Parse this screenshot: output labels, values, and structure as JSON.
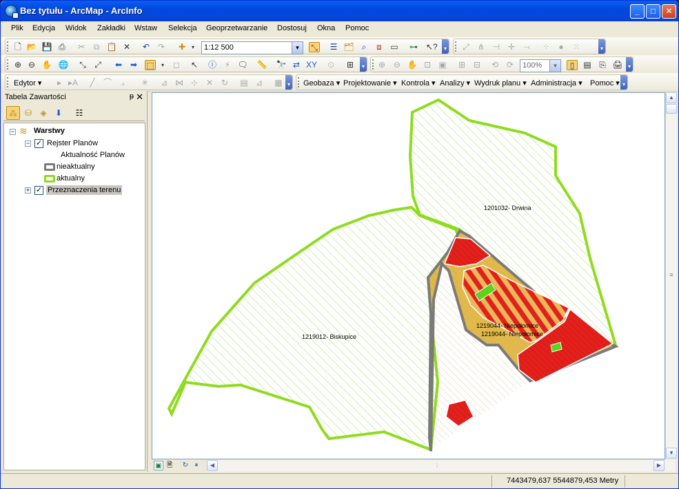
{
  "window": {
    "title": "Bez tytułu - ArcMap - ArcInfo",
    "minimize": "_",
    "maximize": "□",
    "close": "✕"
  },
  "menu": {
    "items": [
      "Plik",
      "Edycja",
      "Widok",
      "Zakładki",
      "Wstaw",
      "Selekcja",
      "Geoprzetwarzanie",
      "Dostosuj",
      "Okna",
      "Pomoc"
    ]
  },
  "toolbar": {
    "scale": "1:12 500",
    "zoom_percent": "100%",
    "editor_label": "Edytor ▾",
    "geoprocessing_menus": [
      "Geobaza ▾",
      "Projektowanie ▾",
      "Kontrola ▾",
      "Analizy ▾",
      "Wydruk planu ▾",
      "Administracja ▾"
    ],
    "help_menu": "Pomoc ▾"
  },
  "toc": {
    "title": "Tabela Zawartości",
    "pin": "ᵽ",
    "close": "✕",
    "root": "Warstwy",
    "layer1": "Rejster Planów",
    "legend_heading": "Aktualność Planów",
    "legend_items": [
      "nieaktualny",
      "aktualny"
    ],
    "layer2": "Przeznaczenia terenu"
  },
  "map": {
    "labels": [
      "1201032- Drwina",
      "1219012- Biskupice",
      "1219044- Niepołomice",
      "1219044- Niepołomice"
    ],
    "colors": {
      "aktualny_outline": "#8fdc1e",
      "nieaktualny_outline": "#7a7a7a",
      "residential": "#e0b84b",
      "commercial": "#e3201b",
      "green": "#5fd31c"
    }
  },
  "status": {
    "coordinates": "7443479,637  5544879,453 Metry"
  }
}
